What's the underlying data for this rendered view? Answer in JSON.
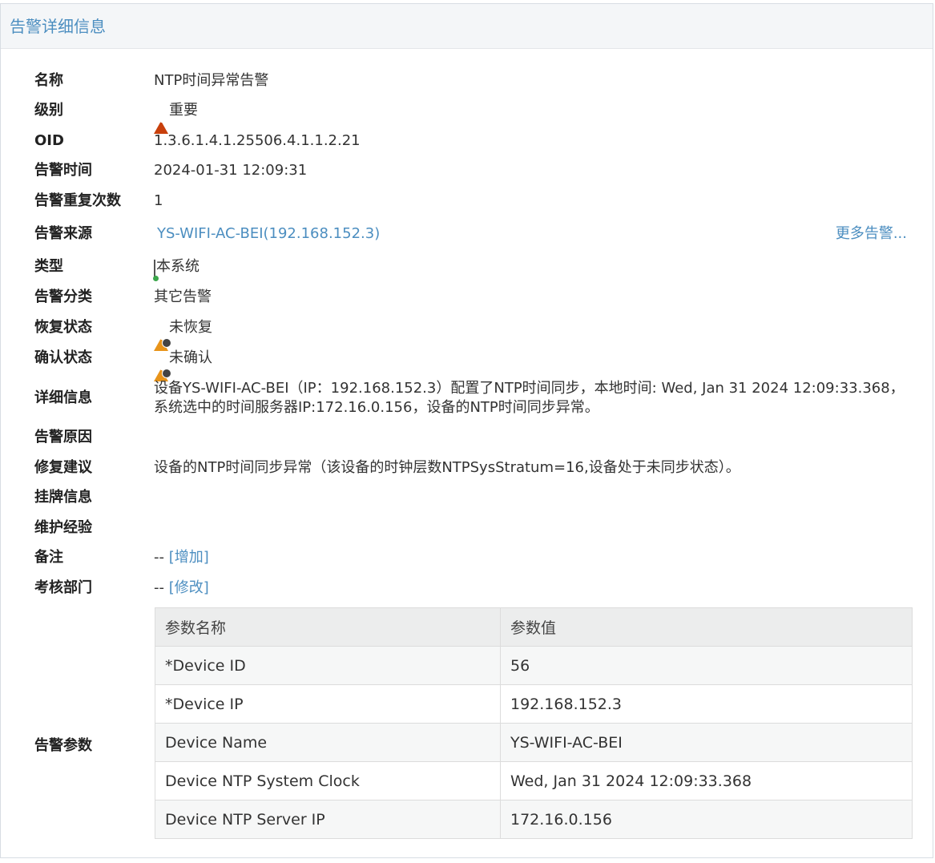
{
  "panel": {
    "title": "告警详细信息"
  },
  "fields": {
    "name": {
      "label": "名称",
      "value": "NTP时间异常告警"
    },
    "level": {
      "label": "级别",
      "value": "重要"
    },
    "oid": {
      "label": "OID",
      "value": "1.3.6.1.4.1.25506.4.1.1.2.21"
    },
    "time": {
      "label": "告警时间",
      "value": "2024-01-31 12:09:31"
    },
    "repeat": {
      "label": "告警重复次数",
      "value": "1"
    },
    "source": {
      "label": "告警来源",
      "value": "YS-WIFI-AC-BEI(192.168.152.3)",
      "more": "更多告警..."
    },
    "type": {
      "label": "类型",
      "value": "本系统"
    },
    "category": {
      "label": "告警分类",
      "value": "其它告警"
    },
    "recover": {
      "label": "恢复状态",
      "value": "未恢复"
    },
    "confirm": {
      "label": "确认状态",
      "value": "未确认"
    },
    "detail": {
      "label": "详细信息",
      "value": "设备YS-WIFI-AC-BEI（IP：192.168.152.3）配置了NTP时间同步，本地时间: Wed, Jan 31 2024 12:09:33.368，系统选中的时间服务器IP:172.16.0.156，设备的NTP时间同步异常。"
    },
    "reason": {
      "label": "告警原因",
      "value": ""
    },
    "suggest": {
      "label": "修复建议",
      "value": "设备的NTP时间同步异常（该设备的时钟层数NTPSysStratum=16,设备处于未同步状态）。"
    },
    "tag": {
      "label": "挂牌信息",
      "value": ""
    },
    "experience": {
      "label": "维护经验",
      "value": ""
    },
    "remark": {
      "label": "备注",
      "value": "--",
      "action": "[增加]"
    },
    "dept": {
      "label": "考核部门",
      "value": "--",
      "action": "[修改]"
    },
    "params": {
      "label": "告警参数"
    }
  },
  "params_table": {
    "headers": [
      "参数名称",
      "参数值"
    ],
    "rows": [
      [
        "*Device ID",
        "56"
      ],
      [
        "*Device IP",
        "192.168.152.3"
      ],
      [
        "Device Name",
        "YS-WIFI-AC-BEI"
      ],
      [
        "Device NTP System Clock",
        "Wed, Jan 31 2024 12:09:33.368"
      ],
      [
        "Device NTP Server IP",
        "172.16.0.156"
      ]
    ]
  }
}
